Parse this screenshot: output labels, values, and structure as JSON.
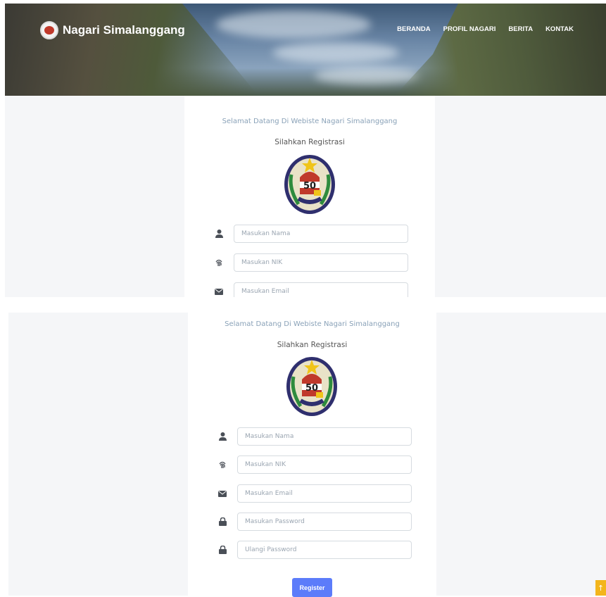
{
  "header": {
    "brand": "Nagari Simalanggang",
    "nav": [
      "BERANDA",
      "PROFIL NAGARI",
      "BERITA",
      "KONTAK"
    ]
  },
  "form": {
    "welcome": "Selamat Datang Di Webiste Nagari Simalanggang",
    "subtitle": "Silahkan Registrasi",
    "seal_text": "50",
    "fields": [
      {
        "placeholder": "Masukan Nama",
        "icon": "user-icon"
      },
      {
        "placeholder": "Masukan NIK",
        "icon": "fingerprint-icon"
      },
      {
        "placeholder": "Masukan Email",
        "icon": "envelope-icon"
      },
      {
        "placeholder": "Masukan Password",
        "icon": "lock-icon"
      },
      {
        "placeholder": "Ulangi Password",
        "icon": "lock-icon"
      }
    ],
    "register_label": "Register"
  },
  "scroll_top": {
    "label": "↑"
  },
  "colors": {
    "accent": "#5c7cfa",
    "welcome_text": "#8aa2b8",
    "scroll_top": "#f3b51c"
  }
}
